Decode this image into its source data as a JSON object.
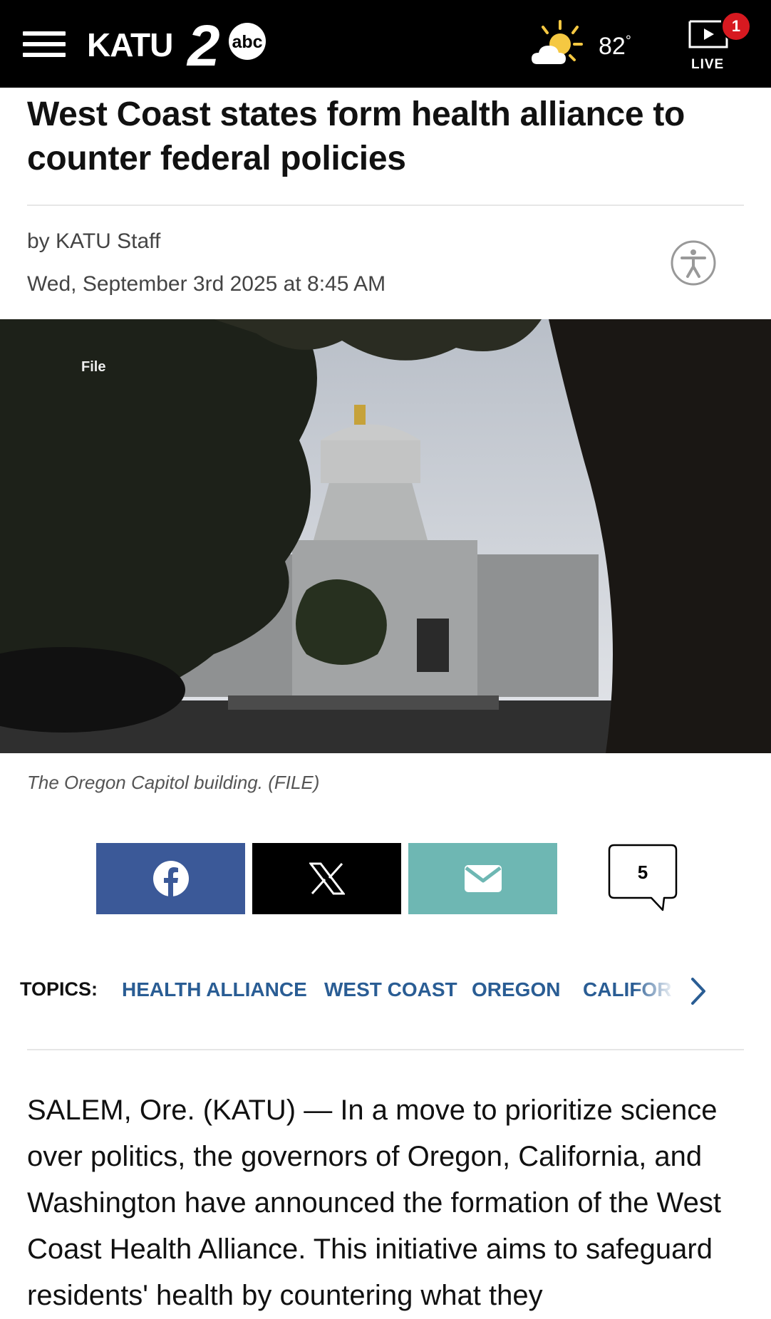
{
  "header": {
    "logo_text": "KATU",
    "logo_number": "2",
    "logo_network": "abc",
    "temperature": "82",
    "temperature_unit": "°",
    "weather_icon": "partly-cloudy-sun-icon",
    "live_label": "LIVE",
    "live_badge": "1",
    "accent_color": "#d71920"
  },
  "article": {
    "headline": "West Coast states form health alliance to counter federal policies",
    "byline": "by KATU Staff",
    "date": "Wed, September 3rd 2025 at 8:45 AM",
    "photo_label": "File",
    "caption": "The Oregon Capitol building. (FILE)",
    "body": "SALEM, Ore. (KATU) — In a move to prioritize science over politics, the governors of Oregon, California, and Washington have announced the formation of the West Coast Health Alliance. This initiative aims to safeguard residents' health by countering what they"
  },
  "share": {
    "facebook_color": "#3b5998",
    "x_color": "#000000",
    "email_color": "#6eb7b3",
    "comment_count": "5"
  },
  "topics": {
    "label": "TOPICS:",
    "items": [
      "HEALTH ALLIANCE",
      "WEST COAST",
      "OREGON",
      "CALIFOR"
    ]
  }
}
